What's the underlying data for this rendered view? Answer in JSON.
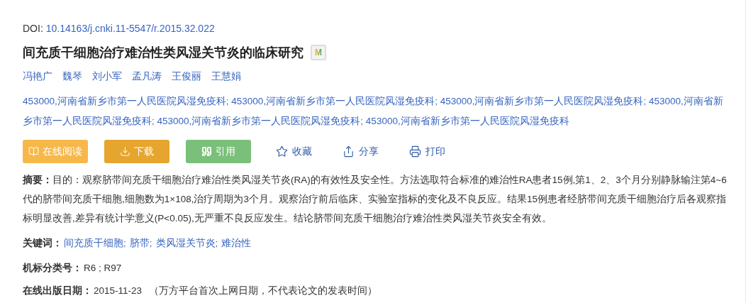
{
  "doi": {
    "label": "DOI:",
    "value": "10.14163/j.cnki.11-5547/r.2015.32.022"
  },
  "title": "间充质干细胞治疗难治性类风湿关节炎的临床研究",
  "badge": "M",
  "authors": [
    "冯艳广",
    "魏琴",
    "刘小军",
    "孟凡涛",
    "王俊丽",
    "王慧娟"
  ],
  "affiliations": [
    "453000,河南省新乡市第一人民医院风湿免疫科;",
    "453000,河南省新乡市第一人民医院风湿免疫科;",
    "453000,河南省新乡市第一人民医院风湿免疫科;",
    "453000,河南省新乡市第一人民医院风湿免疫科;",
    "453000,河南省新乡市第一人民医院风湿免疫科;",
    "453000,河南省新乡市第一人民医院风湿免疫科"
  ],
  "actions": [
    {
      "label": "在线阅读",
      "kind": "filled",
      "color": "#f6b84b"
    },
    {
      "label": "下载",
      "kind": "filled",
      "color": "#e5a52e"
    },
    {
      "label": "引用",
      "kind": "filled",
      "color": "#7bc07a"
    },
    {
      "label": "收藏",
      "kind": "link"
    },
    {
      "label": "分享",
      "kind": "link"
    },
    {
      "label": "打印",
      "kind": "link"
    }
  ],
  "abstract": "**摘要：**目的：观察脐带间充质干细胞治疗难治性类风湿关节炎(RA)的有效性及安全性。方法选取符合标准的难治性RA患者15例,第1、2、3个月分别静脉输注第4~6代的脐带间充质干细胞,细胞数为1×108,治疗周期为3个月。观察治疗前后临床、实验室指标的变化及不良反应。结果15例患者经脐带间充质干细胞治疗后各观察指标明显改善,差异有统计学意义(P<0.05),无严重不良反应发生。结论脐带间充质干细胞治疗难治性类风湿关节炎安全有效。",
  "keywords": {
    "label": "关键词：",
    "items": [
      "间充质干细胞;",
      "脐带;",
      "类风湿关节炎;",
      "难治性"
    ]
  },
  "classification": {
    "label": "机标分类号：",
    "value": "R6 ; R97"
  },
  "publish_date": {
    "label": "在线出版日期：",
    "value": "2015-11-23",
    "note": "（万方平台首次上网日期，不代表论文的发表时间）"
  }
}
